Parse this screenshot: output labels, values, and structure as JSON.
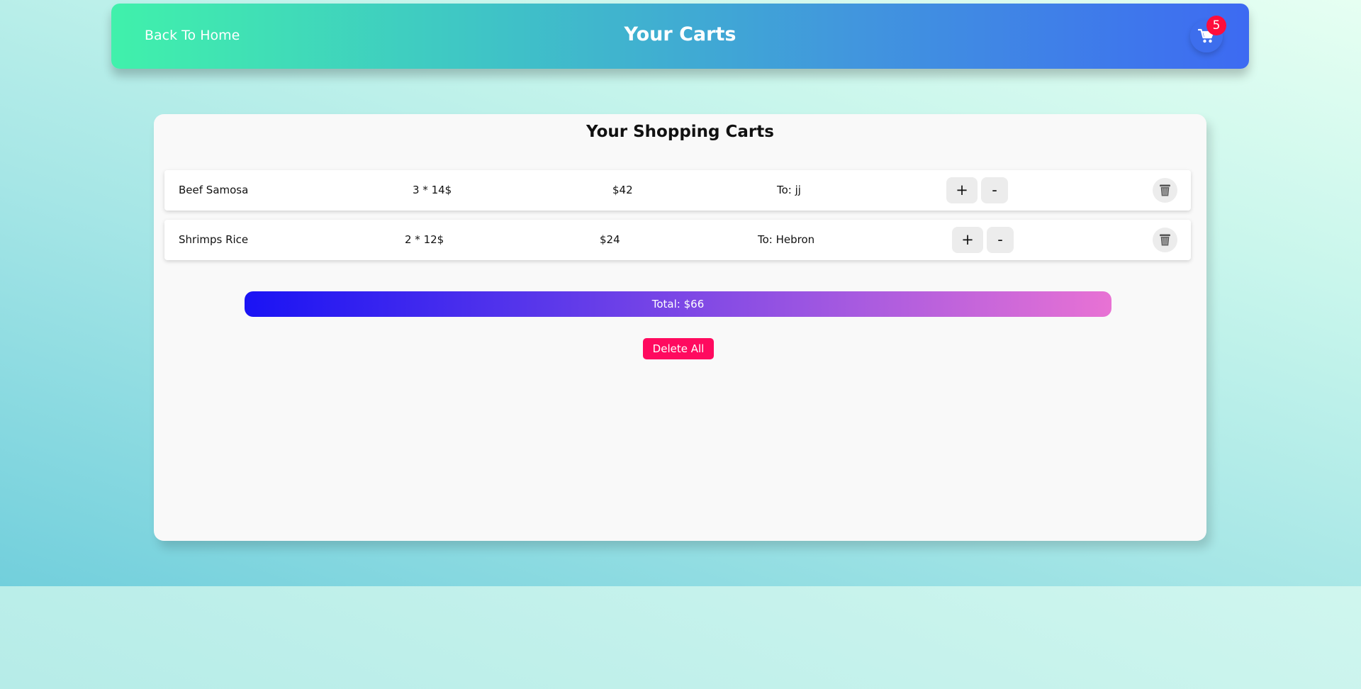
{
  "header": {
    "back_label": "Back To Home",
    "title": "Your Carts",
    "cart_count": "5"
  },
  "cart": {
    "title": "Your Shopping Carts",
    "items": [
      {
        "name": "Beef Samosa",
        "quantity_price": "3 * 14$",
        "subtotal": "$42",
        "destination": "To: jj"
      },
      {
        "name": "Shrimps Rice",
        "quantity_price": "2 * 12$",
        "subtotal": "$24",
        "destination": "To: Hebron"
      }
    ],
    "increase_label": "+",
    "decrease_label": "-",
    "total": "Total: $66",
    "delete_all_label": "Delete All"
  },
  "icons": {
    "cart": "shopping-cart-icon",
    "delete": "trash-icon"
  },
  "colors": {
    "badge": "#ff0d3c",
    "delete_all": "#ff0a5f",
    "header_start": "#40f1ab",
    "header_end": "#3d6af2",
    "total_start": "#1a13f4",
    "total_end": "#e872d4"
  }
}
